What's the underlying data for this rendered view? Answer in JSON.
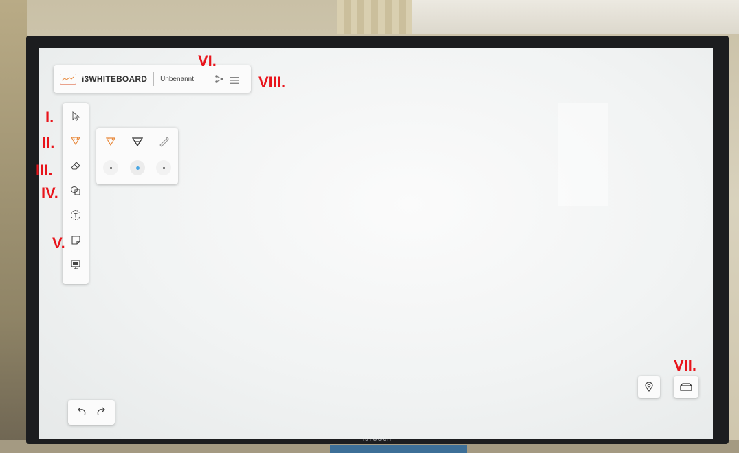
{
  "topbar": {
    "brand": "i3WHITEBOARD",
    "document_title": "Unbenannt"
  },
  "hardware": {
    "brand_label": "i3TOUCH"
  },
  "annotations": {
    "i": "I.",
    "ii": "II.",
    "iii": "III.",
    "iv": "IV.",
    "v": "V.",
    "vi": "VI.",
    "vii": "VII.",
    "viii": "VIII."
  },
  "toolbar": {
    "tools": [
      {
        "name": "select-tool",
        "icon": "cursor-arrow-icon"
      },
      {
        "name": "pen-tool",
        "icon": "fox-pen-icon",
        "active": true
      },
      {
        "name": "eraser-tool",
        "icon": "eraser-icon"
      },
      {
        "name": "shapes-tool",
        "icon": "shapes-icon"
      },
      {
        "name": "text-tool",
        "icon": "text-icon",
        "label": "T"
      },
      {
        "name": "sticky-note-tool",
        "icon": "sticky-note-icon"
      },
      {
        "name": "presentation-tool",
        "icon": "presentation-icon"
      }
    ]
  },
  "pen_options": {
    "pens": [
      "fox-pen-icon",
      "pen-outline-icon",
      "highlighter-icon"
    ],
    "sizes": [
      "small",
      "medium",
      "large"
    ],
    "selected_size": "medium"
  },
  "colors": {
    "accent_orange": "#e8883a",
    "selected_dot_blue": "#48a6e3",
    "annotation_red": "#e8141b"
  }
}
